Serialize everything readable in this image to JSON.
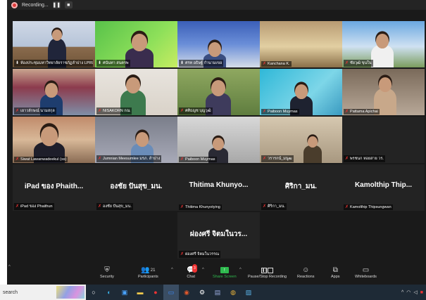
{
  "recording": {
    "label": "Recording...",
    "pause_icon": "pause-icon",
    "stop_icon": "stop-icon"
  },
  "tiles": [
    {
      "name": "ห้องประชุมมหาวิทยาลัยราชภัฏลำปาง LPRU",
      "mic": "on",
      "kind": "video",
      "active": true
    },
    {
      "name": "ศนันทา สนตรพ",
      "mic": "on",
      "kind": "video"
    },
    {
      "name": "ศรท อธิษฐ์ กำนามเขอ",
      "mic": "on",
      "kind": "video"
    },
    {
      "name": "Kanchana K.",
      "mic": "off",
      "kind": "video"
    },
    {
      "name": "ชัยวุฒิ ขุนใน",
      "mic": "off",
      "kind": "video"
    },
    {
      "name": "เยาวลักษณ์ นามสกุล",
      "mic": "off",
      "kind": "video"
    },
    {
      "name": "NISAKORN กณ",
      "mic": "off",
      "kind": "video"
    },
    {
      "name": "ศศิธญช บุญวุฒิ",
      "mic": "off",
      "kind": "video"
    },
    {
      "name": "Paiboon Muymas",
      "mic": "off",
      "kind": "video"
    },
    {
      "name": "Pattama Apichai",
      "mic": "off",
      "kind": "video"
    },
    {
      "name": "Siwat Lawanwadeekul (ss)",
      "mic": "off",
      "kind": "video"
    },
    {
      "name": "Jumnian Meesumlee มรภ. ลำปาง",
      "mic": "off",
      "kind": "video"
    },
    {
      "name": "Paiboon Muymas",
      "mic": "off",
      "kind": "video"
    },
    {
      "name": "วรารกน์_มนูฒ",
      "mic": "off",
      "kind": "video"
    },
    {
      "name": "พรชนก หอยสาย วร.",
      "mic": "off",
      "kind": "blank"
    },
    {
      "name": "iPad ของ Phaithun",
      "mic": "off",
      "kind": "text",
      "display": "iPad ของ Phaith..."
    },
    {
      "name": "องชัย ปันสุข_มน.",
      "mic": "off",
      "kind": "text",
      "display": "องชัย ปันสุข_มน."
    },
    {
      "name": "Thitima Khunyotying",
      "mic": "off",
      "kind": "text",
      "display": "Thitima  Khunyo..."
    },
    {
      "name": "ศิริกา_มน.",
      "mic": "off",
      "kind": "text",
      "display": "ศิริกา_มน."
    },
    {
      "name": "Kamolthip Thipsungwan",
      "mic": "off",
      "kind": "text",
      "display": "Kamolthip  Thip..."
    },
    {
      "name": "ผ่องศรี จิตมในวรรณ",
      "mic": "off",
      "kind": "text",
      "display": "ผ่องศรี จิตมในวร..."
    }
  ],
  "toolbar": {
    "items": [
      {
        "label": "Security",
        "icon": "shield-icon"
      },
      {
        "label": "Participants",
        "icon": "participants-icon",
        "count": "21"
      },
      {
        "label": "Chat",
        "icon": "chat-icon",
        "badge": "3"
      },
      {
        "label": "Share Screen",
        "icon": "share-screen-icon"
      },
      {
        "label": "Pause/Stop Recording",
        "icon": "pause-stop-icon"
      },
      {
        "label": "Reactions",
        "icon": "reactions-icon"
      },
      {
        "label": "Apps",
        "icon": "apps-icon"
      },
      {
        "label": "Whiteboards",
        "icon": "whiteboard-icon"
      }
    ]
  },
  "taskbar": {
    "search_placeholder": "search"
  },
  "colors": {
    "active_border": "#c9e34a",
    "share_green": "#2fbb4f",
    "mic_off": "#e33333"
  }
}
